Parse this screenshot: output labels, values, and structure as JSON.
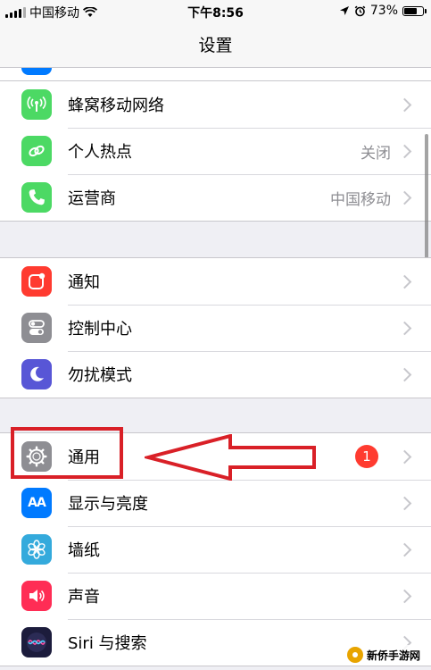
{
  "status_bar": {
    "carrier": "中国移动",
    "time": "下午8:56",
    "battery": "73%",
    "battery_level": 0.73
  },
  "nav": {
    "title": "设置"
  },
  "groups": [
    {
      "items": [
        {
          "label": "蜂窝移动网络",
          "value": "",
          "icon": "antenna-icon",
          "color": "#4cd964"
        },
        {
          "label": "个人热点",
          "value": "关闭",
          "icon": "hotspot-icon",
          "color": "#4cd964"
        },
        {
          "label": "运营商",
          "value": "中国移动",
          "icon": "phone-icon",
          "color": "#4cd964"
        }
      ]
    },
    {
      "items": [
        {
          "label": "通知",
          "icon": "notifications-icon",
          "color": "#ff3b30"
        },
        {
          "label": "控制中心",
          "icon": "control-center-icon",
          "color": "#8e8e93"
        },
        {
          "label": "勿扰模式",
          "icon": "moon-icon",
          "color": "#5856d6"
        }
      ]
    },
    {
      "items": [
        {
          "label": "通用",
          "badge": "1",
          "icon": "gear-icon",
          "color": "#8e8e93"
        },
        {
          "label": "显示与亮度",
          "icon": "aa-icon",
          "color": "#007aff",
          "icon_text": "AA"
        },
        {
          "label": "墙纸",
          "icon": "wallpaper-flower-icon",
          "color": "#34aadc"
        },
        {
          "label": "声音",
          "icon": "speaker-icon",
          "color": "#ff2d55"
        },
        {
          "label": "Siri 与搜索",
          "icon": "siri-icon",
          "color": "#1c1c3c"
        }
      ]
    }
  ],
  "annotations": {
    "box_color": "#d92027",
    "arrow_color": "#d92027"
  },
  "watermark": {
    "text": "新侨手游网"
  }
}
